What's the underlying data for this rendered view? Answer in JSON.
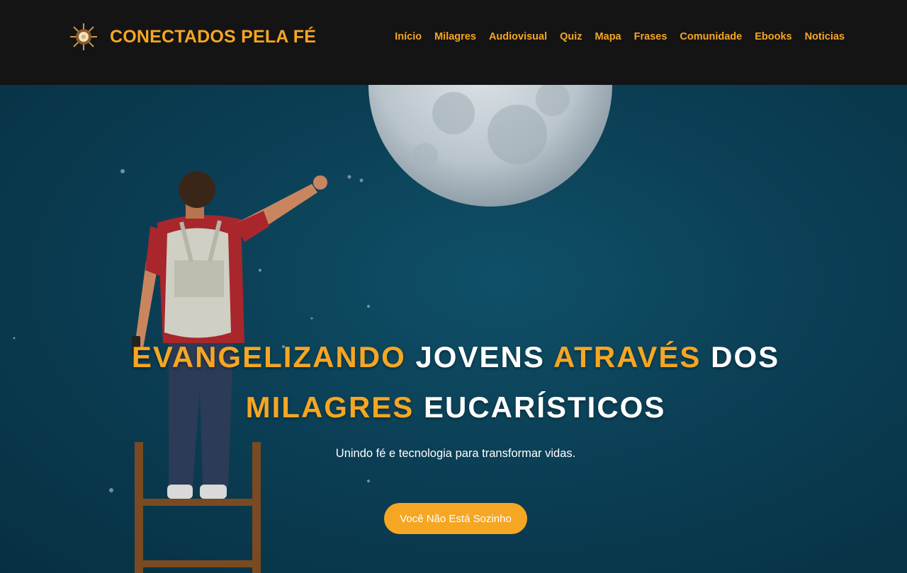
{
  "brand": {
    "title": "CONECTADOS PELA FÉ",
    "logo_icon": "monstrance-icon"
  },
  "nav": {
    "items": [
      {
        "label": "Início"
      },
      {
        "label": "Milagres"
      },
      {
        "label": "Audiovisual"
      },
      {
        "label": "Quiz"
      },
      {
        "label": "Mapa"
      },
      {
        "label": "Frases"
      },
      {
        "label": "Comunidade"
      },
      {
        "label": "Ebooks"
      },
      {
        "label": "Noticias"
      }
    ]
  },
  "hero": {
    "line1": [
      {
        "text": "EVANGELIZANDO",
        "accent": true
      },
      {
        "text": "JOVENS",
        "accent": false
      },
      {
        "text": "ATRAVÉS",
        "accent": true
      },
      {
        "text": "DOS",
        "accent": false
      }
    ],
    "line2": [
      {
        "text": "MILAGRES",
        "accent": true
      },
      {
        "text": "EUCARÍSTICOS",
        "accent": false
      }
    ],
    "subtitle": "Unindo fé e tecnologia para transformar vidas.",
    "cta_label": "Você Não Está Sozinho"
  },
  "colors": {
    "accent": "#f5a623",
    "header_bg": "#141414",
    "hero_bg": "#0b3f55"
  }
}
